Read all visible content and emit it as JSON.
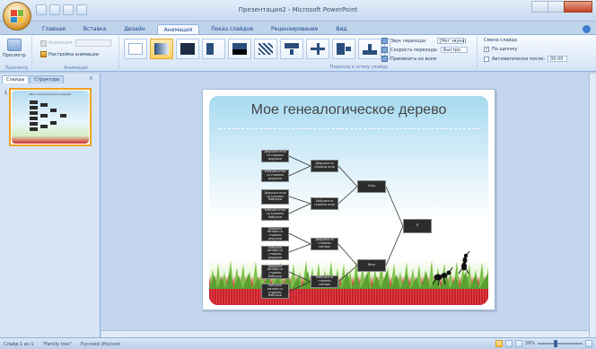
{
  "window": {
    "title": "Презентация2 - Microsoft PowerPoint"
  },
  "tabs": [
    {
      "label": "Главная",
      "active": false
    },
    {
      "label": "Вставка",
      "active": false
    },
    {
      "label": "Дизайн",
      "active": false
    },
    {
      "label": "Анимация",
      "active": true
    },
    {
      "label": "Показ слайдов",
      "active": false
    },
    {
      "label": "Рецензирование",
      "active": false
    },
    {
      "label": "Вид",
      "active": false
    }
  ],
  "ribbon": {
    "preview_group": {
      "button_label": "Просмотр",
      "group_label": "Просмотр"
    },
    "animation_group": {
      "animation_label": "Анимация:",
      "custom_label": "Настройка анимации",
      "group_label": "Анимация"
    },
    "transition_group": {
      "group_label": "Переход к этому слайду",
      "sound_label": "Звук перехода:",
      "sound_value": "[Нет звука]",
      "speed_label": "Скорость перехода:",
      "speed_value": "Быстро",
      "apply_all_label": "Применить ко всем"
    },
    "advance_group": {
      "title": "Смена слайда",
      "on_click_label": "По щелчку",
      "on_click_checked": true,
      "auto_label": "Автоматически после:",
      "auto_value": "00:00",
      "auto_checked": false
    }
  },
  "slides_pane": {
    "tab_slides": "Слайды",
    "tab_outline": "Структура",
    "close": "×",
    "slide_number": "1",
    "thumb_title": "Мое генеалогическое дерево"
  },
  "slide": {
    "title": "Мое генеалогическое дерево",
    "nodes": {
      "gg1": "Дедушка отца со стороны дедушки",
      "gg2": "Бабушка отца со стороны дедушки",
      "gg3": "Дедушка отца со стороны бабушки",
      "gg4": "Бабушка отца со стороны бабушки",
      "gg5": "Дедушка матери со стороны дедушки",
      "gg6": "Бабушка матери со стороны дедушки",
      "gg7": "Дедушка матери со стороны бабушки",
      "gg8": "Бабушка матери со стороны бабушки",
      "g1": "Дедушка со стороны отца",
      "g2": "Бабушка со стороны отца",
      "g3": "Дедушка со стороны матери",
      "g4": "Бабушка со стороны матери",
      "father": "Отец",
      "mother": "Мать",
      "me": "Я"
    }
  },
  "statusbar": {
    "slide_info": "Слайд 1 из 1",
    "theme": "\"Family tree\"",
    "language": "Русский (Россия)",
    "zoom": "39%"
  },
  "colors": {
    "accent": "#f0a020",
    "ribbon_blue": "#15428b",
    "node_fill": "#2c2c2c",
    "red_band": "#c9202a"
  }
}
